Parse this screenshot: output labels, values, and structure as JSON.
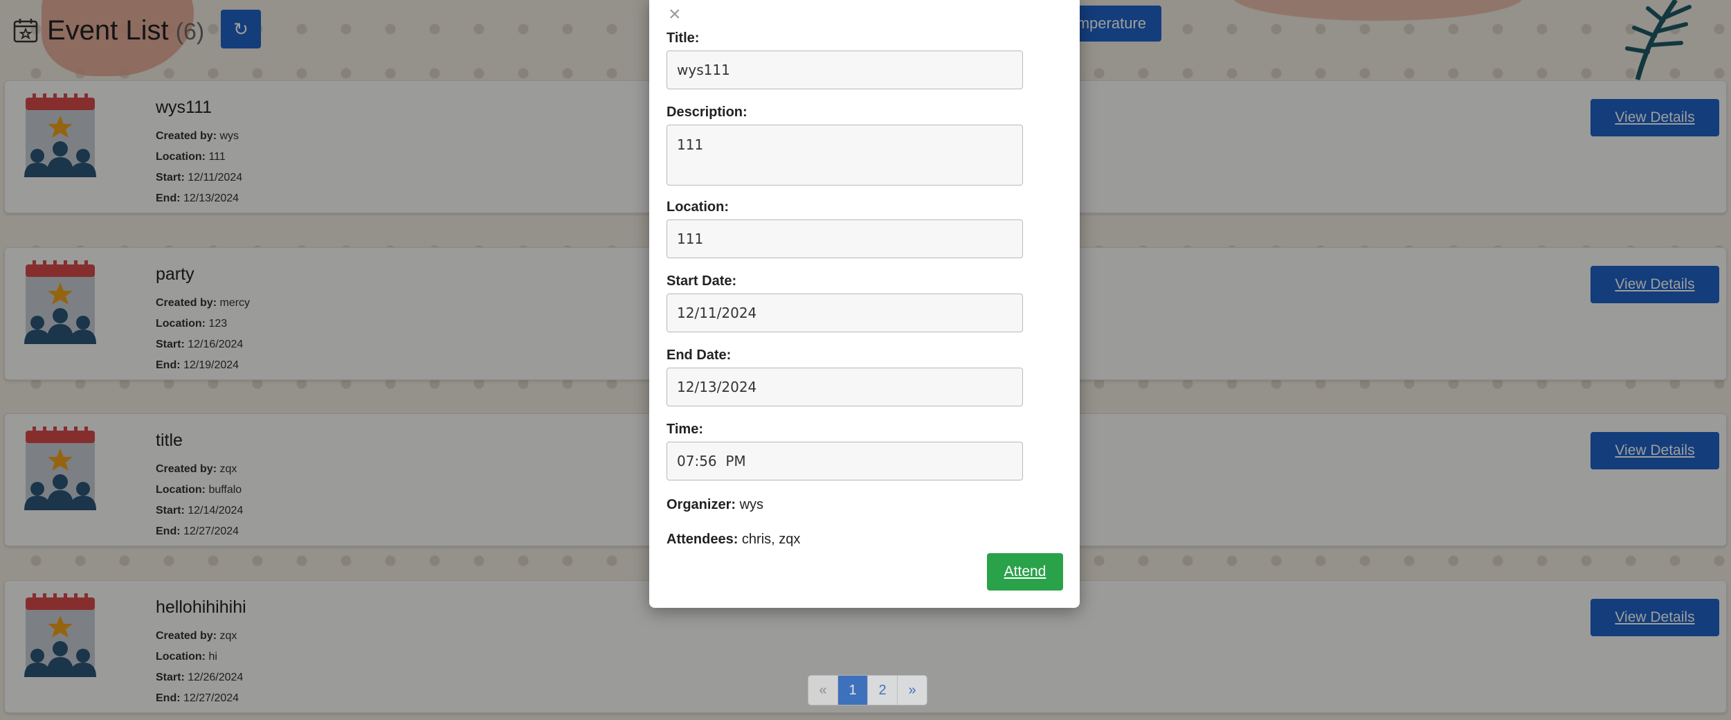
{
  "header": {
    "title": "Event List",
    "count": "(6)",
    "refresh_icon": "↻",
    "temperature_button": "emperature"
  },
  "events": [
    {
      "title": "wys111",
      "created_by_label": "Created by:",
      "created_by": "wys",
      "location_label": "Location:",
      "location": "111",
      "start_label": "Start:",
      "start": "12/11/2024",
      "end_label": "End:",
      "end": "12/13/2024",
      "action": "View Details"
    },
    {
      "title": "party",
      "created_by_label": "Created by:",
      "created_by": "mercy",
      "location_label": "Location:",
      "location": "123",
      "start_label": "Start:",
      "start": "12/16/2024",
      "end_label": "End:",
      "end": "12/19/2024",
      "action": "View Details"
    },
    {
      "title": "title",
      "created_by_label": "Created by:",
      "created_by": "zqx",
      "location_label": "Location:",
      "location": "buffalo",
      "start_label": "Start:",
      "start": "12/14/2024",
      "end_label": "End:",
      "end": "12/27/2024",
      "action": "View Details"
    },
    {
      "title": "hellohihihihi",
      "created_by_label": "Created by:",
      "created_by": "zqx",
      "location_label": "Location:",
      "location": "hi",
      "start_label": "Start:",
      "start": "12/26/2024",
      "end_label": "End:",
      "end": "12/27/2024",
      "action": "View Details"
    }
  ],
  "pagination": {
    "prev": "«",
    "pages": [
      "1",
      "2"
    ],
    "next": "»",
    "active": "1"
  },
  "modal": {
    "close": "×",
    "title_label": "Title:",
    "title_value": "wys111",
    "description_label": "Description:",
    "description_value": "111",
    "location_label": "Location:",
    "location_value": "111",
    "start_label": "Start Date:",
    "start_value": "12/11/2024",
    "end_label": "End Date:",
    "end_value": "12/13/2024",
    "time_label": "Time:",
    "time_value": "07:56  PM",
    "organizer_label": "Organizer:",
    "organizer_value": "wys",
    "attendees_label": "Attendees:",
    "attendees_value": "chris, zqx",
    "attend_button": "Attend"
  },
  "colors": {
    "primary": "#1f63c7",
    "success": "#2aa24a",
    "calendar_red": "#d94b4b",
    "people_blue": "#2c5678",
    "star": "#f0a21a"
  },
  "icons": [
    "calendar-star-icon",
    "event-calendar-people-icon",
    "refresh-icon",
    "close-icon"
  ]
}
